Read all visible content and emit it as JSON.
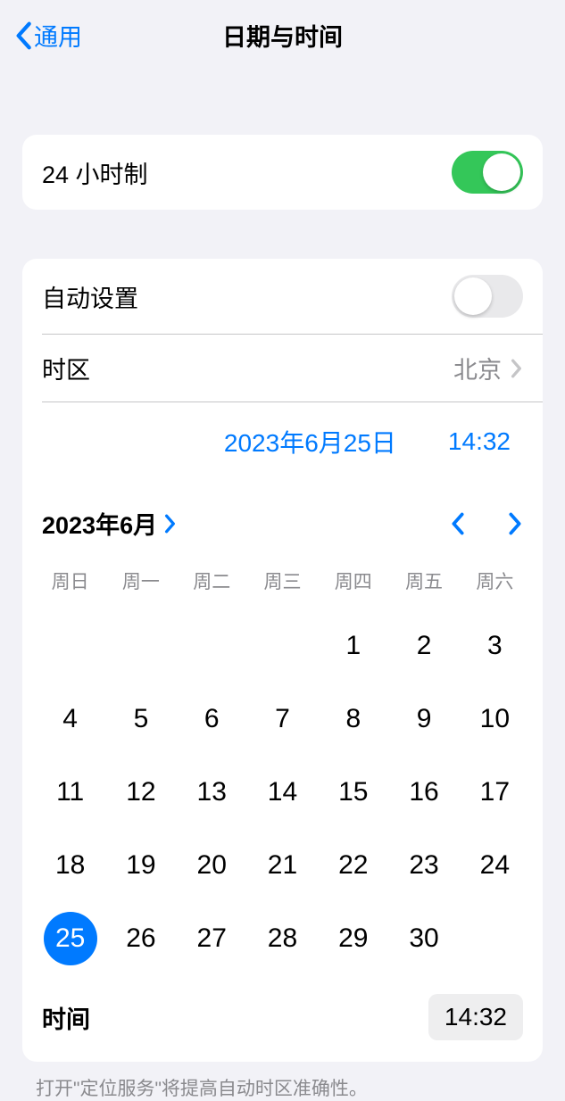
{
  "header": {
    "back_label": "通用",
    "title": "日期与时间"
  },
  "settings": {
    "twentyfour_hour_label": "24 小时制",
    "twentyfour_hour_on": true,
    "auto_set_label": "自动设置",
    "auto_set_on": false,
    "timezone_label": "时区",
    "timezone_value": "北京"
  },
  "datetime": {
    "selected_date_label": "2023年6月25日",
    "selected_time_label": "14:32",
    "month_year_label": "2023年6月",
    "weekdays": [
      "周日",
      "周一",
      "周二",
      "周三",
      "周四",
      "周五",
      "周六"
    ],
    "first_day_index": 4,
    "selected_day": 25,
    "days": [
      "1",
      "2",
      "3",
      "4",
      "5",
      "6",
      "7",
      "8",
      "9",
      "10",
      "11",
      "12",
      "13",
      "14",
      "15",
      "16",
      "17",
      "18",
      "19",
      "20",
      "21",
      "22",
      "23",
      "24",
      "25",
      "26",
      "27",
      "28",
      "29",
      "30"
    ],
    "time_row_label": "时间",
    "time_pill_value": "14:32"
  },
  "footer": {
    "note": "打开\"定位服务\"将提高自动时区准确性。"
  },
  "colors": {
    "accent": "#007aff",
    "switch_on": "#34c759"
  }
}
